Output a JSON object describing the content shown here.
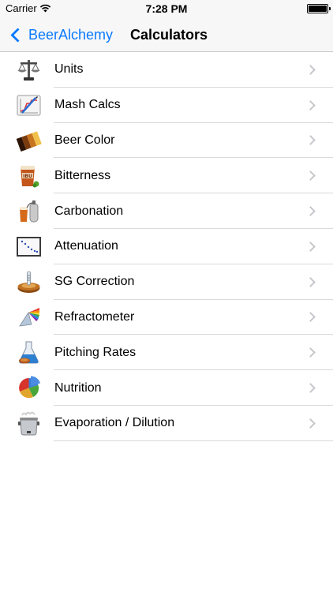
{
  "status_bar": {
    "carrier": "Carrier",
    "time": "7:28 PM"
  },
  "nav": {
    "back_label": "BeerAlchemy",
    "title": "Calculators"
  },
  "colors": {
    "accent": "#0a7aff",
    "separator": "#d9d9de",
    "chevron": "#c7c7cc"
  },
  "items": [
    {
      "label": "Units",
      "icon": "scale-icon"
    },
    {
      "label": "Mash Calcs",
      "icon": "mash-chart-icon"
    },
    {
      "label": "Beer Color",
      "icon": "color-swatch-icon"
    },
    {
      "label": "Bitterness",
      "icon": "ibu-mug-icon"
    },
    {
      "label": "Carbonation",
      "icon": "co2-tank-icon"
    },
    {
      "label": "Attenuation",
      "icon": "attenuation-graph-icon"
    },
    {
      "label": "SG Correction",
      "icon": "hydrometer-icon"
    },
    {
      "label": "Refractometer",
      "icon": "prism-icon"
    },
    {
      "label": "Pitching Rates",
      "icon": "yeast-flask-icon"
    },
    {
      "label": "Nutrition",
      "icon": "pie-chart-icon"
    },
    {
      "label": "Evaporation / Dilution",
      "icon": "kettle-icon"
    }
  ]
}
